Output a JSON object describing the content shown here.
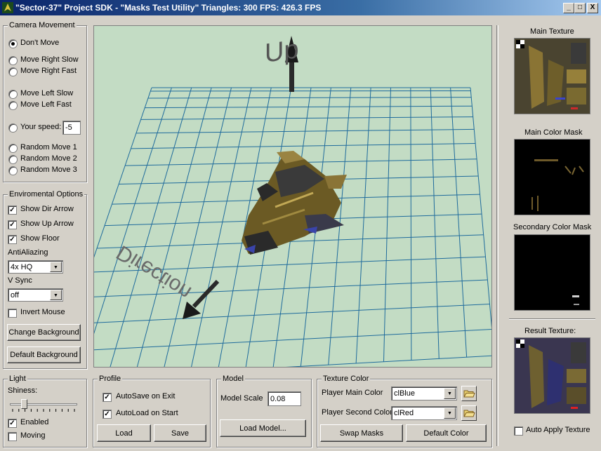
{
  "window": {
    "title": "\"Sector-37\" Project SDK - \"Masks Test Utility\"   Triangles: 300   FPS: 426.3 FPS",
    "minimize": "_",
    "maximize": "□",
    "close": "X"
  },
  "camera": {
    "legend": "Camera Movement",
    "options": [
      "Don't Move",
      "Move Right Slow",
      "Move Right Fast",
      "Move Left Slow",
      "Move Left Fast",
      "Your speed:",
      "Random Move 1",
      "Random Move 2",
      "Random Move 3"
    ],
    "selected": "Don't Move",
    "speed_value": "-5"
  },
  "env": {
    "legend": "Enviromental Options",
    "show_dir_arrow": "Show Dir Arrow",
    "show_up_arrow": "Show Up Arrow",
    "show_floor": "Show Floor",
    "antialiazing_label": "AntiAliazing",
    "antialiazing_value": "4x HQ",
    "vsync_label": "V Sync",
    "vsync_value": "off",
    "invert_mouse": "Invert Mouse",
    "change_bg": "Change Background",
    "default_bg": "Default Background"
  },
  "viewport": {
    "up_label": "Up",
    "direction_label": "Direction"
  },
  "light": {
    "legend": "Light",
    "shininess_label": "Shiness:",
    "shininess_level": 0.18,
    "enabled": "Enabled",
    "moving": "Moving"
  },
  "profile": {
    "legend": "Profile",
    "autosave": "AutoSave on Exit",
    "autoload": "AutoLoad on Start",
    "load": "Load",
    "save": "Save"
  },
  "model": {
    "legend": "Model",
    "scale_label": "Model Scale",
    "scale_value": "0.08",
    "load_model": "Load Model..."
  },
  "texture_color": {
    "legend": "Texture Color",
    "main_label": "Player Main Color",
    "main_value": "clBlue",
    "second_label": "Player Second Color",
    "second_value": "clRed",
    "swap_masks": "Swap Masks",
    "default_color": "Default Color"
  },
  "right_panel": {
    "main_texture": "Main Texture",
    "main_color_mask": "Main Color Mask",
    "secondary_color_mask": "Secondary Color Mask",
    "result_texture": "Result Texture:",
    "auto_apply": "Auto Apply Texture"
  },
  "colors": {
    "title_start": "#0a246a",
    "title_end": "#a6caf0",
    "viewport_bg": "#c3dcc4",
    "grid": "#1f6b9c",
    "panel": "#d4d0c8"
  }
}
